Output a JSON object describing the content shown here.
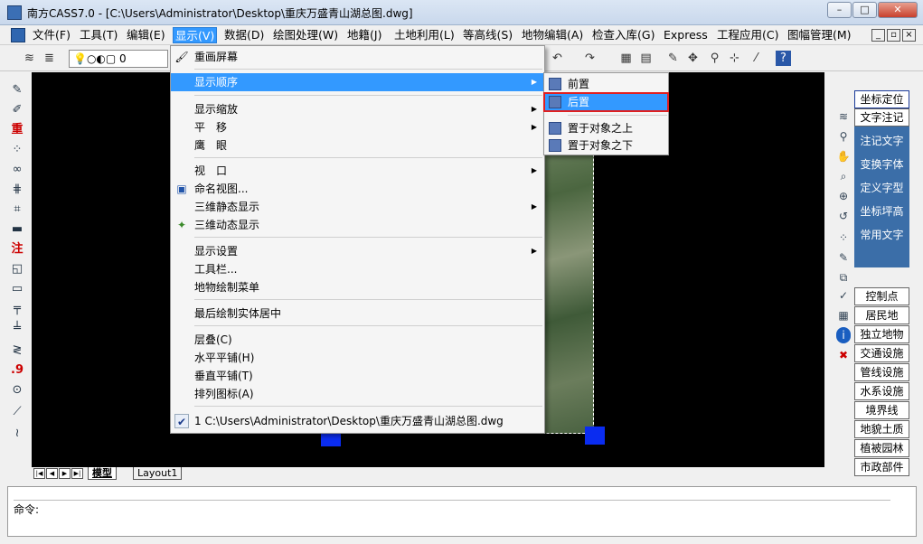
{
  "window": {
    "title": "南方CASS7.0 - [C:\\Users\\Administrator\\Desktop\\重庆万盛青山湖总图.dwg]",
    "controls": [
      "–",
      "□",
      "✕"
    ]
  },
  "menubar": {
    "items": [
      "文件(F)",
      "工具(T)",
      "编辑(E)",
      "显示(V)",
      "数据(D)",
      "绘图处理(W)",
      "地籍(J)",
      "土地利用(L)",
      "等高线(S)",
      "地物编辑(A)",
      "检查入库(G)",
      "Express",
      "工程应用(C)",
      "图幅管理(M)"
    ],
    "active_index": 3,
    "mdi_controls": [
      "_",
      "▫",
      "×"
    ]
  },
  "toolbar": {
    "layer_value": "0"
  },
  "display_menu": {
    "items": [
      {
        "label": "重画屏幕",
        "icon": "brush-icon"
      },
      {
        "label": "显示顺序",
        "submenu": true,
        "hover": true
      },
      {
        "label": "显示缩放",
        "submenu": true
      },
      {
        "label": "平　移",
        "submenu": true
      },
      {
        "label": "鹰　眼"
      },
      {
        "label": "视　口",
        "submenu": true
      },
      {
        "label": "命名视图...",
        "icon": "named-view-icon"
      },
      {
        "label": "三维静态显示",
        "submenu": true
      },
      {
        "label": "三维动态显示",
        "icon": "orbit-icon"
      },
      {
        "label": "显示设置",
        "submenu": true
      },
      {
        "label": "工具栏..."
      },
      {
        "label": "地物绘制菜单"
      },
      {
        "label": "最后绘制实体居中"
      },
      {
        "label": "层叠(C)"
      },
      {
        "label": "水平平铺(H)"
      },
      {
        "label": "垂直平铺(T)"
      },
      {
        "label": "排列图标(A)"
      },
      {
        "label": "1 C:\\Users\\Administrator\\Desktop\\重庆万盛青山湖总图.dwg",
        "checked": true
      }
    ]
  },
  "order_submenu": {
    "items": [
      {
        "label": "前置"
      },
      {
        "label": "后置",
        "hover": true
      },
      {
        "label": "置于对象之上"
      },
      {
        "label": "置于对象之下"
      }
    ]
  },
  "layout_tabs": {
    "tabs": [
      "模型",
      "Layout1"
    ],
    "active": "模型"
  },
  "command": {
    "prompt": "命令:"
  },
  "right_panel": {
    "buttons_top": [
      "坐标定位",
      "文字注记"
    ],
    "text_items": [
      "注记文字",
      "变换字体",
      "定义字型",
      "坐标坪高",
      "常用文字"
    ],
    "buttons_bottom": [
      "控制点",
      "居民地",
      "独立地物",
      "交通设施",
      "管线设施",
      "水系设施",
      "境界线",
      "地貌土质",
      "植被园林",
      "市政部件"
    ]
  }
}
